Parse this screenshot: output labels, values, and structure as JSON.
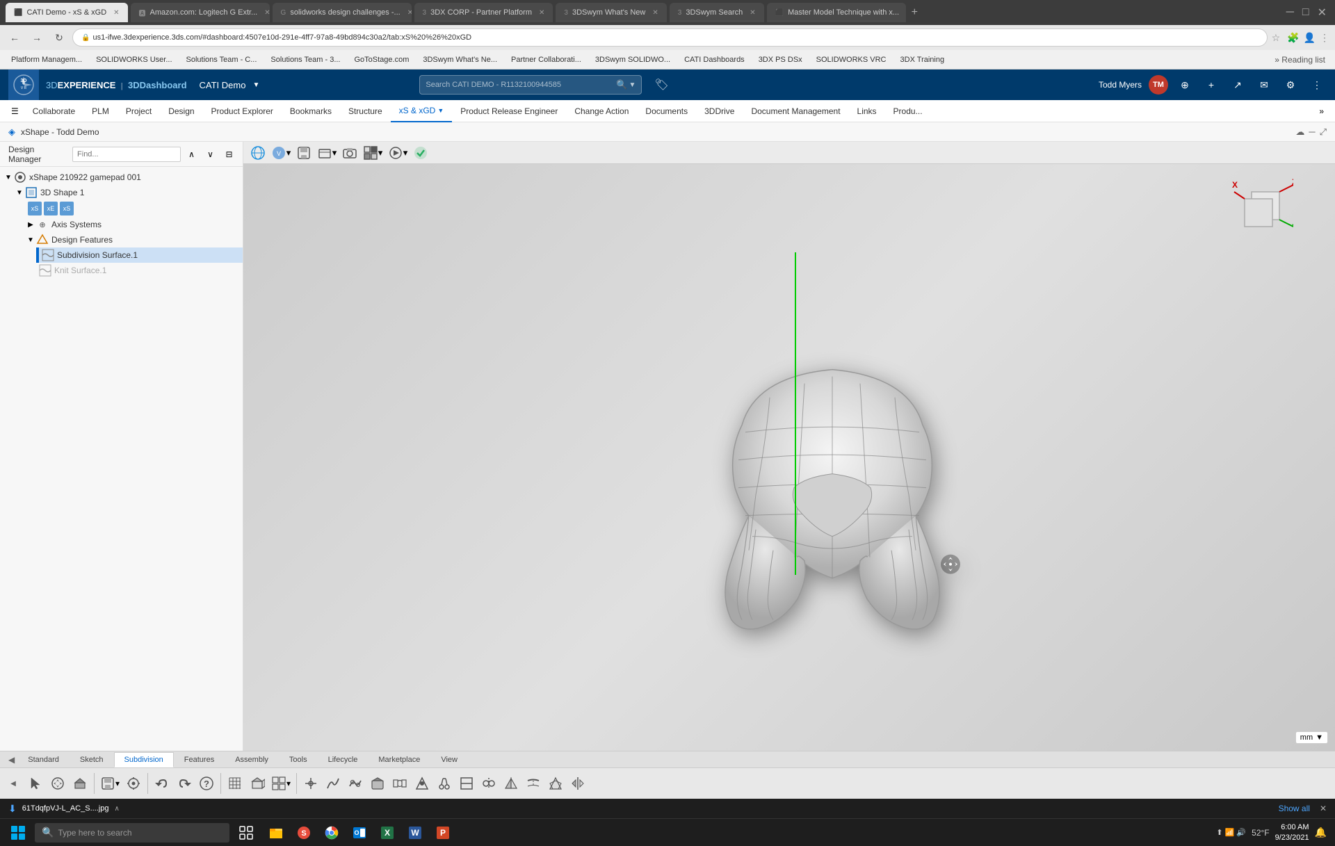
{
  "browser": {
    "tabs": [
      {
        "label": "CATI Demo - xS & xGD",
        "active": true
      },
      {
        "label": "Amazon.com: Logitech G Extr...",
        "active": false
      },
      {
        "label": "solidworks design challenges -...",
        "active": false
      },
      {
        "label": "3DX CORP - Partner Platform",
        "active": false
      },
      {
        "label": "3DSwym What's New",
        "active": false
      },
      {
        "label": "3DSwym Search",
        "active": false
      },
      {
        "label": "Master Model Technique with x...",
        "active": false
      }
    ],
    "address": "us1-ifwe.3dexperience.3ds.com/#dashboard:4507e10d-291e-4ff7-97a8-49bd894c30a2/tab:xS%20%26%20xGD",
    "bookmarks": [
      "Platform Managem...",
      "SOLIDWORKS User...",
      "Solutions Team - C...",
      "Solutions Team - 3...",
      "GoToStage.com",
      "3DSwym What's Ne...",
      "Partner Collaborati...",
      "3DSwym SOLIDWO...",
      "CATI Dashboards",
      "3DX PS DSx",
      "SOLIDWORKS VRC",
      "3DX Training"
    ]
  },
  "app": {
    "title_3d": "3D",
    "title_experience": "EXPERIENCE",
    "title_app": "3DDashboard",
    "company": "CATI Demo",
    "search_placeholder": "Search CATI DEMO - R1132100944585",
    "user": "Todd Myers",
    "user_initials": "TM"
  },
  "nav_menu": {
    "items": [
      {
        "label": "Collaborate"
      },
      {
        "label": "PLM"
      },
      {
        "label": "Project"
      },
      {
        "label": "Design"
      },
      {
        "label": "Product Explorer"
      },
      {
        "label": "Bookmarks"
      },
      {
        "label": "Structure"
      },
      {
        "label": "xS & xGD",
        "active": true
      },
      {
        "label": "Product Release Engineer"
      },
      {
        "label": "Change Action"
      },
      {
        "label": "Documents"
      },
      {
        "label": "3DDrive"
      },
      {
        "label": "Document Management"
      },
      {
        "label": "Links"
      },
      {
        "label": "Produ..."
      }
    ]
  },
  "page": {
    "title": "xShape - Todd Demo",
    "collapse_icon": "◀"
  },
  "sidebar": {
    "label": "Design Manager",
    "find_placeholder": "Find...",
    "tree": {
      "root": {
        "label": "xShape 210922 gamepad 001",
        "children": [
          {
            "label": "3D Shape 1",
            "children": [
              {
                "label": "Axis Systems"
              },
              {
                "label": "Design Features",
                "children": [
                  {
                    "label": "Subdivision Surface.1",
                    "active": true
                  },
                  {
                    "label": "Knit Surface.1",
                    "greyed": true
                  }
                ]
              }
            ]
          }
        ]
      }
    }
  },
  "viewport": {
    "unit": "mm",
    "unit_arrow": "▼"
  },
  "bottom_tabs": [
    {
      "label": "Standard"
    },
    {
      "label": "Sketch"
    },
    {
      "label": "Subdivision",
      "active": true
    },
    {
      "label": "Features"
    },
    {
      "label": "Assembly"
    },
    {
      "label": "Tools"
    },
    {
      "label": "Lifecycle"
    },
    {
      "label": "Marketplace"
    },
    {
      "label": "View"
    }
  ],
  "status_bar": {
    "file": "61TdqfpVJ-L_AC_S....jpg",
    "show_all": "Show all",
    "close": "✕"
  },
  "taskbar": {
    "search_placeholder": "Type here to search",
    "time": "6:00 AM",
    "date": "9/23/2021",
    "temperature": "52°F",
    "apps": [
      "⊞",
      "🔍",
      "📁",
      "",
      "",
      "",
      "",
      "",
      "",
      "",
      "",
      "",
      "",
      "",
      "",
      ""
    ]
  },
  "icons": {
    "search": "🔍",
    "settings": "⚙",
    "close": "✕",
    "expand": "▶",
    "collapse": "▼",
    "chevron_right": "❯",
    "chevron_left": "❮",
    "hamburger": "☰",
    "more": "»",
    "undo": "↶",
    "redo": "↷",
    "help": "?",
    "grid": "⊞"
  }
}
